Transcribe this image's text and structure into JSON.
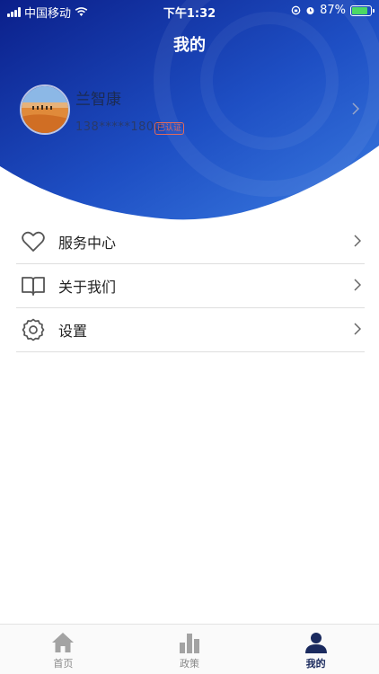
{
  "status_bar": {
    "carrier": "中国移动",
    "time": "下午1:32",
    "battery": "87%"
  },
  "header": {
    "title": "我的"
  },
  "profile": {
    "name": "兰智康",
    "phone": "138*****1800",
    "badge": "已认证",
    "avatar": "desert-camels-photo"
  },
  "menu": {
    "items": [
      {
        "label": "服务中心",
        "icon": "heart-icon"
      },
      {
        "label": "关于我们",
        "icon": "book-icon"
      },
      {
        "label": "设置",
        "icon": "gear-icon"
      }
    ]
  },
  "tab_bar": {
    "tabs": [
      {
        "label": "首页",
        "icon": "home-icon",
        "active": false
      },
      {
        "label": "政策",
        "icon": "bar-chart-icon",
        "active": false
      },
      {
        "label": "我的",
        "icon": "user-icon",
        "active": true
      }
    ]
  },
  "colors": {
    "header_dark": "#0f2a9c",
    "header_light": "#2f6fd6",
    "active_tab": "#1a2a5e",
    "badge": "#e16a5b"
  }
}
